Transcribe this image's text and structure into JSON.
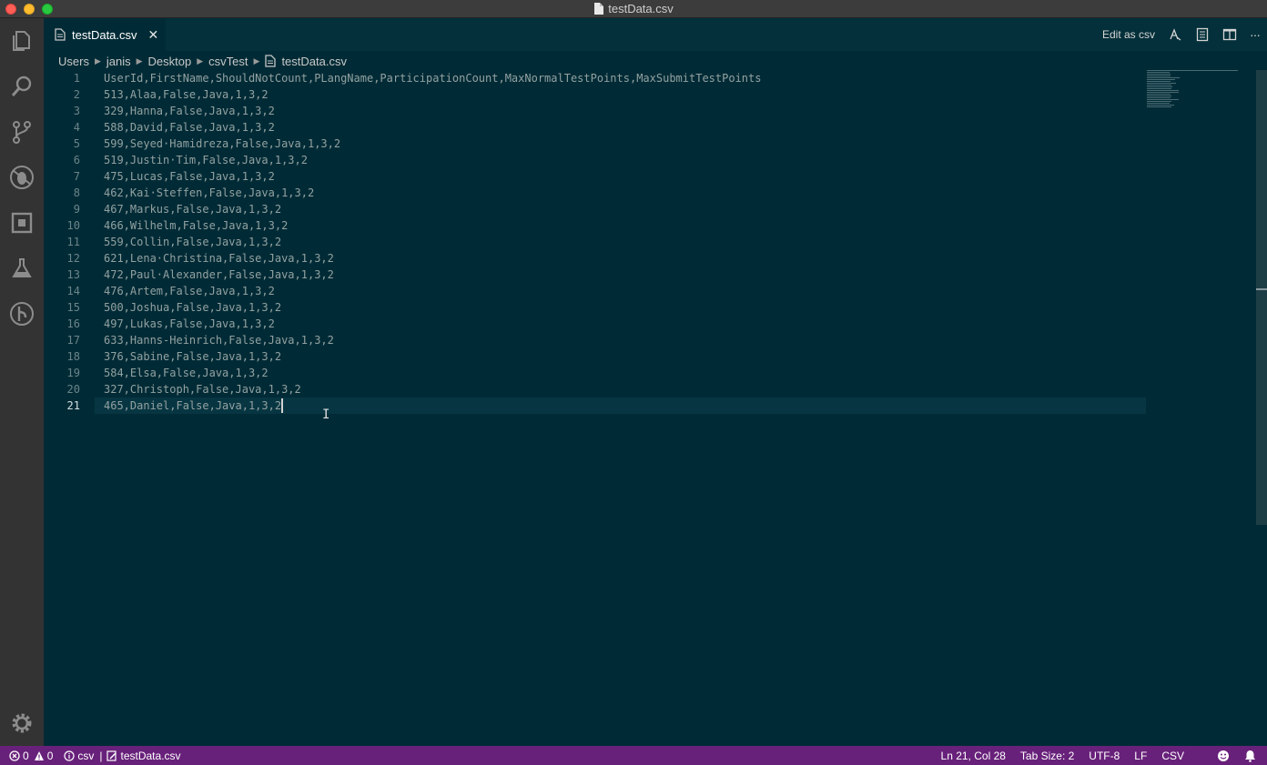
{
  "window": {
    "title": "testData.csv"
  },
  "tab": {
    "label": "testData.csv",
    "close": "✕"
  },
  "tab_actions": {
    "edit_as_csv": "Edit as csv",
    "more": "···"
  },
  "breadcrumb": [
    "Users",
    "janis",
    "Desktop",
    "csvTest",
    "testData.csv"
  ],
  "editor": {
    "active_line": 21,
    "lines": [
      "UserId,FirstName,ShouldNotCount,PLangName,ParticipationCount,MaxNormalTestPoints,MaxSubmitTestPoints",
      "513,Alaa,False,Java,1,3,2",
      "329,Hanna,False,Java,1,3,2",
      "588,David,False,Java,1,3,2",
      "599,Seyed·Hamidreza,False,Java,1,3,2",
      "519,Justin·Tim,False,Java,1,3,2",
      "475,Lucas,False,Java,1,3,2",
      "462,Kai·Steffen,False,Java,1,3,2",
      "467,Markus,False,Java,1,3,2",
      "466,Wilhelm,False,Java,1,3,2",
      "559,Collin,False,Java,1,3,2",
      "621,Lena·Christina,False,Java,1,3,2",
      "472,Paul·Alexander,False,Java,1,3,2",
      "476,Artem,False,Java,1,3,2",
      "500,Joshua,False,Java,1,3,2",
      "497,Lukas,False,Java,1,3,2",
      "633,Hanns-Heinrich,False,Java,1,3,2",
      "376,Sabine,False,Java,1,3,2",
      "584,Elsa,False,Java,1,3,2",
      "327,Christoph,False,Java,1,3,2",
      "465,Daniel,False,Java,1,3,2"
    ]
  },
  "statusbar": {
    "errors": "0",
    "warnings": "0",
    "language_hint": "csv",
    "file": "testData.csv",
    "position": "Ln 21, Col 28",
    "tab_size": "Tab Size: 2",
    "encoding": "UTF-8",
    "eol": "LF",
    "language": "CSV"
  },
  "colors": {
    "editor_bg": "#002b36",
    "statusbar_bg": "#68217a",
    "activitybar_bg": "#333333"
  },
  "icons": [
    "files-icon",
    "search-icon",
    "source-control-icon",
    "debug-icon",
    "extensions-icon",
    "flask-icon",
    "git-graph-icon",
    "gear-icon"
  ]
}
